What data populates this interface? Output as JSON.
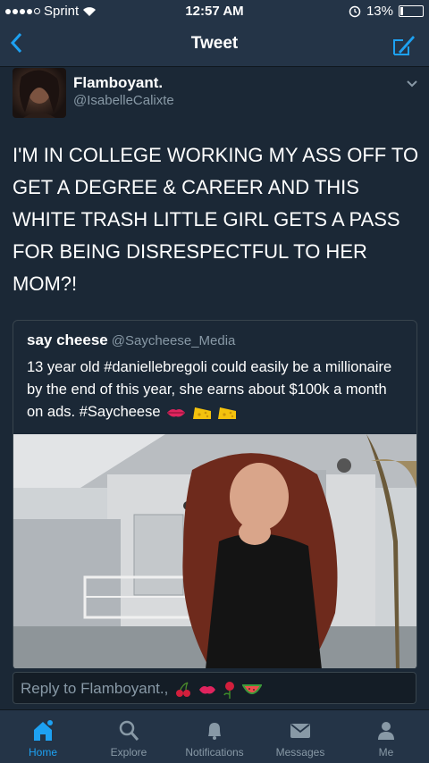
{
  "status": {
    "carrier": "Sprint",
    "time": "12:57 AM",
    "battery": "13%"
  },
  "nav": {
    "title": "Tweet"
  },
  "tweet": {
    "name": "Flamboyant.",
    "handle": "@IsabelleCalixte",
    "text": "I'M IN COLLEGE WORKING MY ASS OFF TO GET A DEGREE & CAREER AND THIS WHITE TRASH LITTLE GIRL GETS A PASS FOR BEING DISRESPECTFUL TO HER MOM?!"
  },
  "quote": {
    "name": "say cheese",
    "handle": "@Saycheese_Media",
    "text": "13 year old #daniellebregoli could easily be a millionaire by the end of this year, she earns about $100k a month on ads. #Saycheese",
    "emojis": [
      "lips-emoji",
      "cheese-emoji",
      "cheese-emoji"
    ]
  },
  "reply": {
    "placeholder": "Reply to Flamboyant.,"
  },
  "tabs": [
    {
      "label": "Home",
      "icon": "home-icon",
      "active": true
    },
    {
      "label": "Explore",
      "icon": "search-icon",
      "active": false
    },
    {
      "label": "Notifications",
      "icon": "bell-icon",
      "active": false
    },
    {
      "label": "Messages",
      "icon": "envelope-icon",
      "active": false
    },
    {
      "label": "Me",
      "icon": "person-icon",
      "active": false
    }
  ],
  "colors": {
    "accent": "#1da1f2",
    "background": "#1b2836",
    "bars": "#243447",
    "muted": "#8899a6"
  }
}
